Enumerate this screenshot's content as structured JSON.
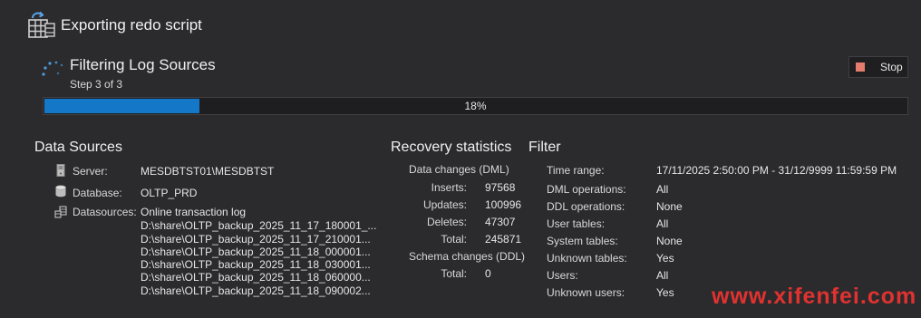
{
  "header": {
    "title": "Exporting redo script",
    "icon": "export-icon"
  },
  "step": {
    "title": "Filtering Log Sources",
    "subtitle": "Step 3 of 3"
  },
  "stop_button": {
    "label": "Stop",
    "color": "#e47d6d"
  },
  "progress": {
    "value": 0.18,
    "text": "18%",
    "color": "#1577c7"
  },
  "data_sources": {
    "title": "Data Sources",
    "server": {
      "label": "Server:",
      "value": "MESDBTST01\\MESDBTST",
      "icon": "server-icon"
    },
    "database": {
      "label": "Database:",
      "value": "OLTP_PRD",
      "icon": "database-icon"
    },
    "datasources": {
      "label": "Datasources:",
      "icon": "datasources-icon",
      "items": [
        "Online transaction log",
        "D:\\share\\OLTP_backup_2025_11_17_180001_...",
        "D:\\share\\OLTP_backup_2025_11_17_210001...",
        "D:\\share\\OLTP_backup_2025_11_18_000001...",
        "D:\\share\\OLTP_backup_2025_11_18_030001...",
        "D:\\share\\OLTP_backup_2025_11_18_060000...",
        "D:\\share\\OLTP_backup_2025_11_18_090002..."
      ]
    }
  },
  "recovery": {
    "title": "Recovery statistics",
    "dml_header": "Data changes (DML)",
    "inserts": {
      "label": "Inserts:",
      "value": "97568"
    },
    "updates": {
      "label": "Updates:",
      "value": "100996"
    },
    "deletes": {
      "label": "Deletes:",
      "value": "47307"
    },
    "dml_total": {
      "label": "Total:",
      "value": "245871"
    },
    "ddl_header": "Schema changes (DDL)",
    "ddl_total": {
      "label": "Total:",
      "value": "0"
    }
  },
  "filter": {
    "title": "Filter",
    "rows": [
      {
        "label": "Time range:",
        "value": "17/11/2025 2:50:00 PM - 31/12/9999 11:59:59 PM"
      },
      {
        "label": "DML operations:",
        "value": "All"
      },
      {
        "label": "DDL operations:",
        "value": "None"
      },
      {
        "label": "User tables:",
        "value": "All"
      },
      {
        "label": "System tables:",
        "value": "None"
      },
      {
        "label": "Unknown tables:",
        "value": "Yes"
      },
      {
        "label": "Users:",
        "value": "All"
      },
      {
        "label": "Unknown users:",
        "value": "Yes"
      }
    ]
  },
  "watermark": "www.xifenfei.com"
}
